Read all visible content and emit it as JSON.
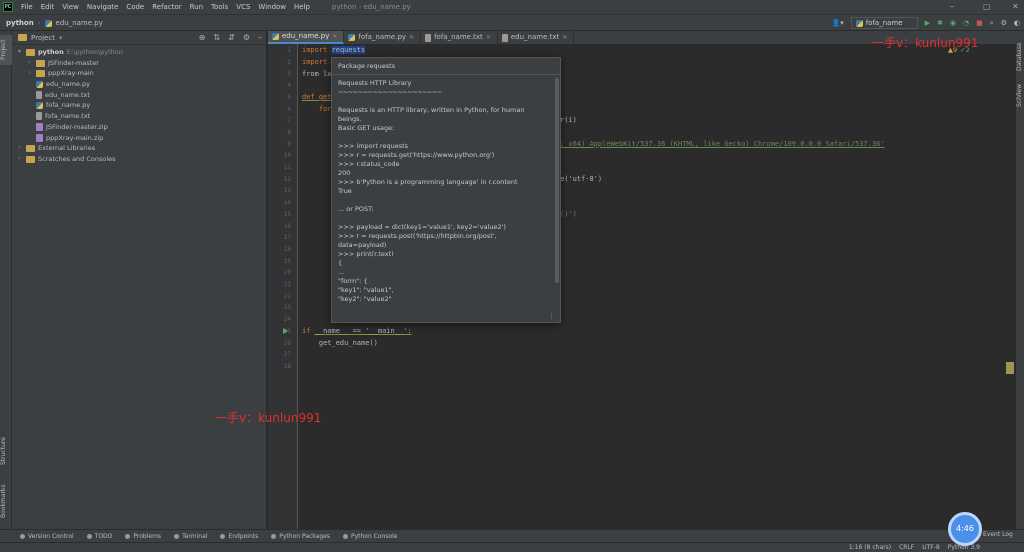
{
  "app": {
    "name": "PC",
    "window_title": "python - edu_name.py"
  },
  "menu": [
    "File",
    "Edit",
    "View",
    "Navigate",
    "Code",
    "Refactor",
    "Run",
    "Tools",
    "VCS",
    "Window",
    "Help"
  ],
  "window_controls": {
    "min": "–",
    "max": "▢",
    "close": "✕"
  },
  "nav": {
    "project": "python",
    "file": "edu_name.py",
    "run_config": "fofa_name"
  },
  "left_strip": {
    "project": "Project",
    "structure": "Structure",
    "bookmarks": "Bookmarks"
  },
  "right_strip": {
    "database": "Database",
    "sciview": "SciView"
  },
  "project_panel": {
    "title": "Project",
    "tree": [
      {
        "indent": 0,
        "arrow": "▾",
        "icon": "folder",
        "name": "python",
        "path": "E:\\python\\python"
      },
      {
        "indent": 1,
        "arrow": "›",
        "icon": "folder",
        "name": "JSFinder-master",
        "path": ""
      },
      {
        "indent": 1,
        "arrow": "›",
        "icon": "folder",
        "name": "pppXray-main",
        "path": ""
      },
      {
        "indent": 1,
        "arrow": "",
        "icon": "py",
        "name": "edu_name.py",
        "path": ""
      },
      {
        "indent": 1,
        "arrow": "",
        "icon": "txt",
        "name": "edu_name.txt",
        "path": ""
      },
      {
        "indent": 1,
        "arrow": "",
        "icon": "py",
        "name": "fofa_name.py",
        "path": ""
      },
      {
        "indent": 1,
        "arrow": "",
        "icon": "txt",
        "name": "fofa_name.txt",
        "path": ""
      },
      {
        "indent": 1,
        "arrow": "",
        "icon": "zip",
        "name": "JSFinder-master.zip",
        "path": ""
      },
      {
        "indent": 1,
        "arrow": "",
        "icon": "zip",
        "name": "pppXray-main.zip",
        "path": ""
      },
      {
        "indent": 0,
        "arrow": "›",
        "icon": "lib",
        "name": "External Libraries",
        "path": ""
      },
      {
        "indent": 0,
        "arrow": "›",
        "icon": "scratch",
        "name": "Scratches and Consoles",
        "path": ""
      }
    ]
  },
  "tabs": [
    {
      "label": "edu_name.py",
      "icon": "py",
      "active": true
    },
    {
      "label": "fofa_name.py",
      "icon": "py",
      "active": false
    },
    {
      "label": "fofa_name.txt",
      "icon": "txt",
      "active": false
    },
    {
      "label": "edu_name.txt",
      "icon": "txt",
      "active": false
    }
  ],
  "inspections": {
    "warnings": "▲9",
    "weak": "✓2"
  },
  "code": {
    "line1_kw": "import ",
    "line1_mod": "requests",
    "line2": "import",
    "line3": "from lx",
    "line5": "def get",
    "line6": "    for",
    "frag_a": "r(i)",
    "frag_b": "; x64) AppleWebKit/537.36 (KHTML, like Gecko) Chrome/109.0.0.0 Safari/537.36'",
    "frag_c": "e('utf-8')",
    "frag_d": "()')",
    "line26_kw": "if ",
    "line26_rest": "__name__ == '__main__':",
    "line27": "    get_edu_name()"
  },
  "line_numbers": [
    "1",
    "2",
    "3",
    "4",
    "5",
    "6",
    "7",
    "8",
    "9",
    "10",
    "11",
    "12",
    "13",
    "14",
    "15",
    "16",
    "17",
    "18",
    "19",
    "20",
    "21",
    "22",
    "23",
    "24",
    "25",
    "26",
    "27",
    "28"
  ],
  "popup": {
    "header": "Package requests",
    "lines": [
      "Requests HTTP Library",
      "~~~~~~~~~~~~~~~~~~~~~",
      "",
      "Requests is an HTTP library, written in Python, for human",
      "beings.",
      "Basic GET usage:",
      "",
      ">>> import requests",
      ">>> r = requests.get('https://www.python.org')",
      ">>> r.status_code",
      "200",
      ">>> b'Python is a programming language' in r.content",
      "True",
      "",
      "... or POST:",
      "",
      ">>> payload = dict(key1='value1', key2='value2')",
      ">>> r = requests.post('https://httpbin.org/post',",
      "data=payload)",
      ">>> print(r.text)",
      "{",
      "...",
      "\"form\": {",
      "\"key1\": \"value1\",",
      "\"key2\": \"value2\""
    ],
    "more": "⋮"
  },
  "watermark": "一手v：kunlun991",
  "toolwindows": [
    "Version Control",
    "TODO",
    "Problems",
    "Terminal",
    "Endpoints",
    "Python Packages",
    "Python Console"
  ],
  "event_log": "Event Log",
  "status": {
    "position": "1:16 (8 chars)",
    "line_sep": "CRLF",
    "encoding": "UTF-8",
    "interpreter": "Python 3.9"
  },
  "timer": "4:46"
}
